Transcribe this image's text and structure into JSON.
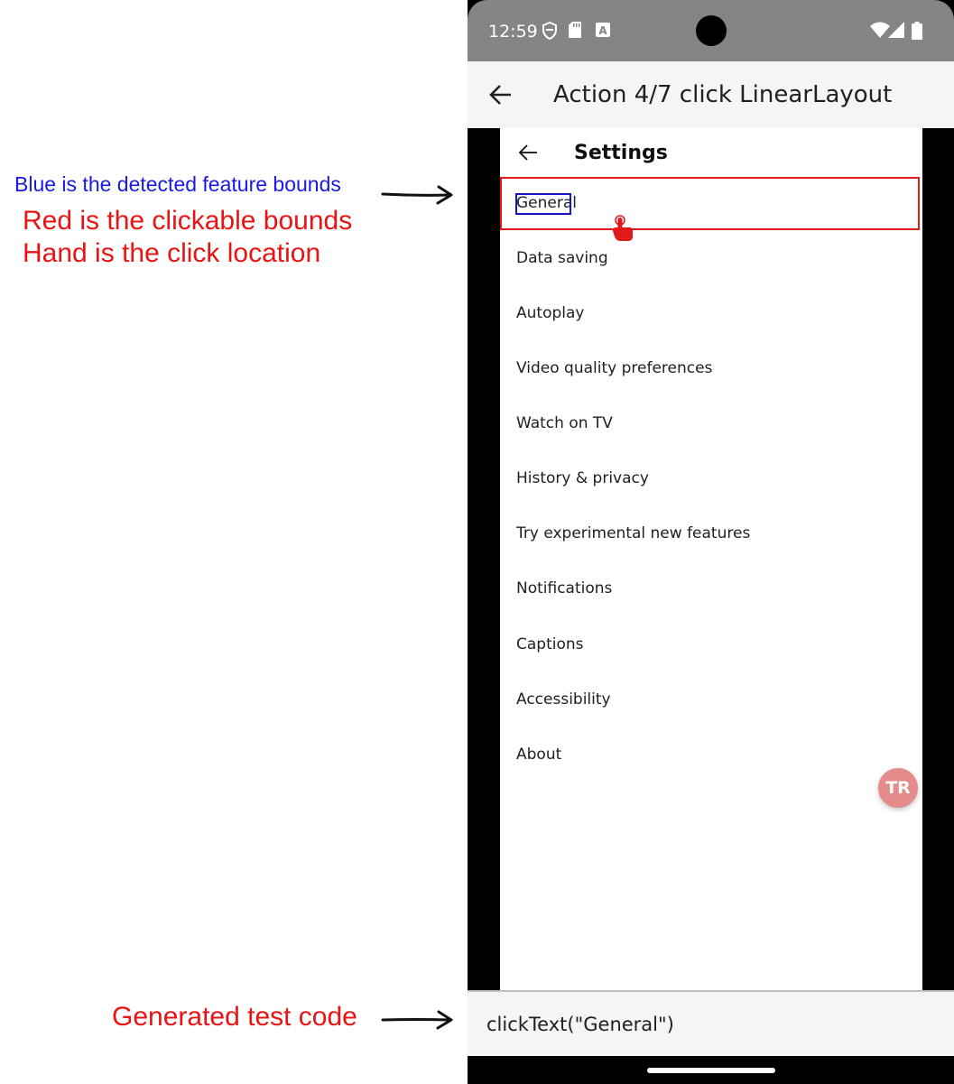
{
  "legend": {
    "blue_text": "Blue is the detected feature bounds",
    "red_text_1": "Red is the clickable bounds",
    "red_text_2": "Hand is the click location",
    "code_label": "Generated test code"
  },
  "status_bar": {
    "time": "12:59"
  },
  "app_bar": {
    "title": "Action 4/7 click LinearLayout"
  },
  "settings": {
    "title": "Settings",
    "items": [
      {
        "label": "General"
      },
      {
        "label": "Data saving"
      },
      {
        "label": "Autoplay"
      },
      {
        "label": "Video quality preferences"
      },
      {
        "label": "Watch on TV"
      },
      {
        "label": "History & privacy"
      },
      {
        "label": "Try experimental new features"
      },
      {
        "label": "Notifications"
      },
      {
        "label": "Captions"
      },
      {
        "label": "Accessibility"
      },
      {
        "label": "About"
      }
    ]
  },
  "badge": {
    "text": "TR"
  },
  "generated_code": "clickText(\"General\")",
  "colors": {
    "feature_bounds": "#1515c8",
    "clickable_bounds": "#e01919",
    "status_bar": "#838586"
  }
}
